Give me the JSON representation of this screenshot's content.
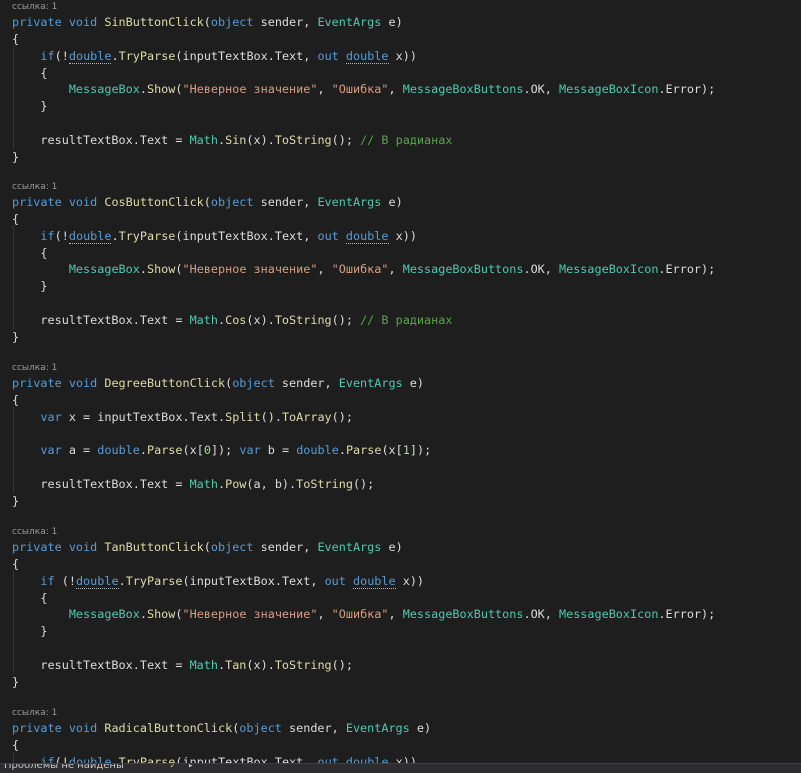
{
  "editor": {
    "blocks": [
      {
        "codelens": "ссылка: 1",
        "lines": [
          [
            [
              "kw",
              "private "
            ],
            [
              "kw",
              "void "
            ],
            [
              "mt",
              "SinButtonClick"
            ],
            [
              "pl",
              "("
            ],
            [
              "kw",
              "object "
            ],
            [
              "pl",
              "sender, "
            ],
            [
              "tp",
              "EventArgs "
            ],
            [
              "pl",
              "e)"
            ]
          ],
          [
            [
              "pl",
              "{"
            ]
          ],
          [
            [
              "pl",
              "    "
            ],
            [
              "kw",
              "if"
            ],
            [
              "pl",
              "(!"
            ],
            [
              "kwsq",
              "double"
            ],
            [
              "pl",
              "."
            ],
            [
              "mt",
              "TryParse"
            ],
            [
              "pl",
              "(inputTextBox.Text, "
            ],
            [
              "kw",
              "out "
            ],
            [
              "kwsq",
              "double"
            ],
            [
              "pl",
              " x))"
            ]
          ],
          [
            [
              "pl",
              "    {"
            ]
          ],
          [
            [
              "pl",
              "        "
            ],
            [
              "tp",
              "MessageBox"
            ],
            [
              "pl",
              "."
            ],
            [
              "mt",
              "Show"
            ],
            [
              "pl",
              "("
            ],
            [
              "st",
              "\"Неверное значение\""
            ],
            [
              "pl",
              ", "
            ],
            [
              "st",
              "\"Ошибка\""
            ],
            [
              "pl",
              ", "
            ],
            [
              "tp",
              "MessageBoxButtons"
            ],
            [
              "pl",
              ".OK, "
            ],
            [
              "tp",
              "MessageBoxIcon"
            ],
            [
              "pl",
              ".Error);"
            ]
          ],
          [
            [
              "pl",
              "    }"
            ]
          ],
          [],
          [
            [
              "pl",
              "    resultTextBox.Text = "
            ],
            [
              "tp",
              "Math"
            ],
            [
              "pl",
              "."
            ],
            [
              "mt",
              "Sin"
            ],
            [
              "pl",
              "(x)."
            ],
            [
              "mt",
              "ToString"
            ],
            [
              "pl",
              "(); "
            ],
            [
              "cm",
              "// В радианах"
            ]
          ],
          [
            [
              "pl",
              "}"
            ]
          ]
        ]
      },
      {
        "codelens": "ссылка: 1",
        "lines": [
          [
            [
              "kw",
              "private "
            ],
            [
              "kw",
              "void "
            ],
            [
              "mt",
              "CosButtonClick"
            ],
            [
              "pl",
              "("
            ],
            [
              "kw",
              "object "
            ],
            [
              "pl",
              "sender, "
            ],
            [
              "tp",
              "EventArgs "
            ],
            [
              "pl",
              "e)"
            ]
          ],
          [
            [
              "pl",
              "{"
            ]
          ],
          [
            [
              "pl",
              "    "
            ],
            [
              "kw",
              "if"
            ],
            [
              "pl",
              "(!"
            ],
            [
              "kwsq",
              "double"
            ],
            [
              "pl",
              "."
            ],
            [
              "mt",
              "TryParse"
            ],
            [
              "pl",
              "(inputTextBox.Text, "
            ],
            [
              "kw",
              "out "
            ],
            [
              "kwsq",
              "double"
            ],
            [
              "pl",
              " x))"
            ]
          ],
          [
            [
              "pl",
              "    {"
            ]
          ],
          [
            [
              "pl",
              "        "
            ],
            [
              "tp",
              "MessageBox"
            ],
            [
              "pl",
              "."
            ],
            [
              "mt",
              "Show"
            ],
            [
              "pl",
              "("
            ],
            [
              "st",
              "\"Неверное значение\""
            ],
            [
              "pl",
              ", "
            ],
            [
              "st",
              "\"Ошибка\""
            ],
            [
              "pl",
              ", "
            ],
            [
              "tp",
              "MessageBoxButtons"
            ],
            [
              "pl",
              ".OK, "
            ],
            [
              "tp",
              "MessageBoxIcon"
            ],
            [
              "pl",
              ".Error);"
            ]
          ],
          [
            [
              "pl",
              "    }"
            ]
          ],
          [],
          [
            [
              "pl",
              "    resultTextBox.Text = "
            ],
            [
              "tp",
              "Math"
            ],
            [
              "pl",
              "."
            ],
            [
              "mt",
              "Cos"
            ],
            [
              "pl",
              "(x)."
            ],
            [
              "mt",
              "ToString"
            ],
            [
              "pl",
              "(); "
            ],
            [
              "cm",
              "// В радианах"
            ]
          ],
          [
            [
              "pl",
              "}"
            ]
          ]
        ]
      },
      {
        "codelens": "ссылка: 1",
        "lines": [
          [
            [
              "kw",
              "private "
            ],
            [
              "kw",
              "void "
            ],
            [
              "mt",
              "DegreeButtonClick"
            ],
            [
              "pl",
              "("
            ],
            [
              "kw",
              "object "
            ],
            [
              "pl",
              "sender, "
            ],
            [
              "tp",
              "EventArgs "
            ],
            [
              "pl",
              "e)"
            ]
          ],
          [
            [
              "pl",
              "{"
            ]
          ],
          [
            [
              "pl",
              "    "
            ],
            [
              "kw",
              "var "
            ],
            [
              "pl",
              "x = inputTextBox.Text."
            ],
            [
              "mt",
              "Split"
            ],
            [
              "pl",
              "()."
            ],
            [
              "mt",
              "ToArray"
            ],
            [
              "pl",
              "();"
            ]
          ],
          [],
          [
            [
              "pl",
              "    "
            ],
            [
              "kw",
              "var "
            ],
            [
              "pl",
              "a = "
            ],
            [
              "kw",
              "double"
            ],
            [
              "pl",
              "."
            ],
            [
              "mt",
              "Parse"
            ],
            [
              "pl",
              "(x["
            ],
            [
              "nm",
              "0"
            ],
            [
              "pl",
              "]); "
            ],
            [
              "kw",
              "var "
            ],
            [
              "pl",
              "b = "
            ],
            [
              "kw",
              "double"
            ],
            [
              "pl",
              "."
            ],
            [
              "mt",
              "Parse"
            ],
            [
              "pl",
              "(x["
            ],
            [
              "nm",
              "1"
            ],
            [
              "pl",
              "]);"
            ]
          ],
          [],
          [
            [
              "pl",
              "    resultTextBox.Text = "
            ],
            [
              "tp",
              "Math"
            ],
            [
              "pl",
              "."
            ],
            [
              "mt",
              "Pow"
            ],
            [
              "pl",
              "(a, b)."
            ],
            [
              "mt",
              "ToString"
            ],
            [
              "pl",
              "();"
            ]
          ],
          [
            [
              "pl",
              "}"
            ]
          ]
        ]
      },
      {
        "codelens": "ссылка: 1",
        "lines": [
          [
            [
              "kw",
              "private "
            ],
            [
              "kw",
              "void "
            ],
            [
              "mt",
              "TanButtonClick"
            ],
            [
              "pl",
              "("
            ],
            [
              "kw",
              "object "
            ],
            [
              "pl",
              "sender, "
            ],
            [
              "tp",
              "EventArgs "
            ],
            [
              "pl",
              "e)"
            ]
          ],
          [
            [
              "pl",
              "{"
            ]
          ],
          [
            [
              "pl",
              "    "
            ],
            [
              "kw",
              "if "
            ],
            [
              "pl",
              "(!"
            ],
            [
              "kwsq",
              "double"
            ],
            [
              "pl",
              "."
            ],
            [
              "mt",
              "TryParse"
            ],
            [
              "pl",
              "(inputTextBox.Text, "
            ],
            [
              "kw",
              "out "
            ],
            [
              "kwsq",
              "double"
            ],
            [
              "pl",
              " x))"
            ]
          ],
          [
            [
              "pl",
              "    {"
            ]
          ],
          [
            [
              "pl",
              "        "
            ],
            [
              "tp",
              "MessageBox"
            ],
            [
              "pl",
              "."
            ],
            [
              "mt",
              "Show"
            ],
            [
              "pl",
              "("
            ],
            [
              "st",
              "\"Неверное значение\""
            ],
            [
              "pl",
              ", "
            ],
            [
              "st",
              "\"Ошибка\""
            ],
            [
              "pl",
              ", "
            ],
            [
              "tp",
              "MessageBoxButtons"
            ],
            [
              "pl",
              ".OK, "
            ],
            [
              "tp",
              "MessageBoxIcon"
            ],
            [
              "pl",
              ".Error);"
            ]
          ],
          [
            [
              "pl",
              "    }"
            ]
          ],
          [],
          [
            [
              "pl",
              "    resultTextBox.Text = "
            ],
            [
              "tp",
              "Math"
            ],
            [
              "pl",
              "."
            ],
            [
              "mt",
              "Tan"
            ],
            [
              "pl",
              "(x)."
            ],
            [
              "mt",
              "ToString"
            ],
            [
              "pl",
              "();"
            ]
          ],
          [
            [
              "pl",
              "}"
            ]
          ]
        ]
      },
      {
        "codelens": "ссылка: 1",
        "lines": [
          [
            [
              "kw",
              "private "
            ],
            [
              "kw",
              "void "
            ],
            [
              "mt",
              "RadicalButtonClick"
            ],
            [
              "pl",
              "("
            ],
            [
              "kw",
              "object "
            ],
            [
              "pl",
              "sender, "
            ],
            [
              "tp",
              "EventArgs "
            ],
            [
              "pl",
              "e)"
            ]
          ],
          [
            [
              "pl",
              "{"
            ]
          ],
          [
            [
              "pl",
              "    "
            ],
            [
              "kw",
              "if"
            ],
            [
              "pl",
              "(!"
            ],
            [
              "kwsq",
              "double"
            ],
            [
              "pl",
              "."
            ],
            [
              "mt",
              "TryParse"
            ],
            [
              "pl",
              "(inputTextBox.Text, "
            ],
            [
              "kw",
              "out "
            ],
            [
              "kwsq",
              "double"
            ],
            [
              "pl",
              " x))"
            ]
          ]
        ]
      }
    ]
  },
  "statusbar": {
    "text": "Проблемы не найдены"
  },
  "colors": {
    "background": "#1e1e1e",
    "keyword": "#569cd6",
    "type": "#4ec9b0",
    "method": "#dcdcaa",
    "string": "#d69d85",
    "comment": "#57a64a",
    "number": "#b5cea8",
    "plain": "#dcdcdc"
  },
  "icons": [
    "status-check-icon",
    "status-arrow-icon"
  ]
}
